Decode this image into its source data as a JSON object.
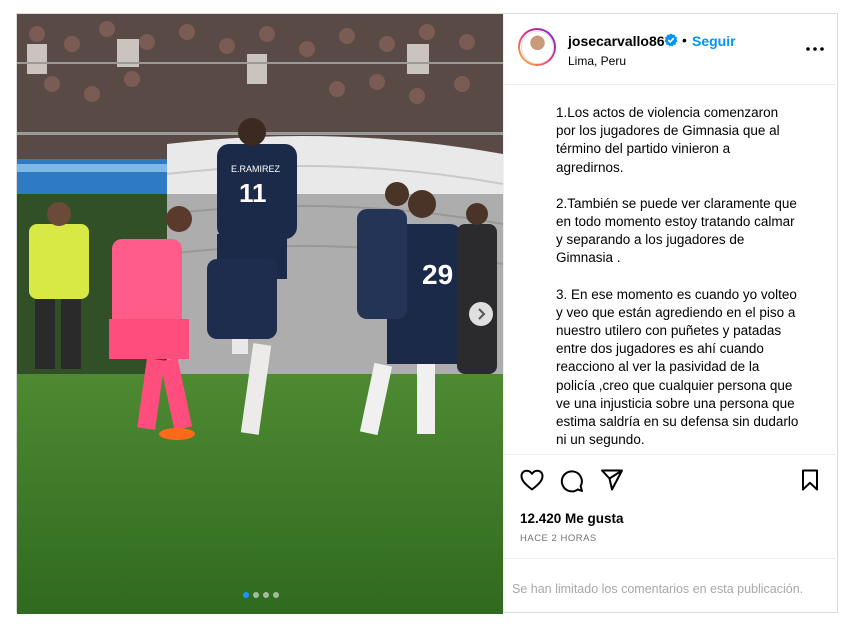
{
  "post": {
    "username": "josecarvallo86",
    "follow_label": "Seguir",
    "separator": "•",
    "location": "Lima, Peru",
    "caption": [
      "1.Los actos de violencia comenzaron por los jugadores de Gimnasia que al término del partido vinieron a agredirnos.",
      "2.También se puede ver claramente que en todo momento estoy tratando calmar y separando a los jugadores de Gimnasia .",
      "3. En ese momento es cuando yo volteo y veo que están agrediendo en el piso a nuestro utilero con puñetes y patadas entre dos jugadores es ahí cuando reacciono al ver la pasividad de la policía ,creo que cualquier persona que ve una injusticia sobre una persona que estima saldría en su defensa sin dudarlo ni un segundo."
    ],
    "likes": "12.420 Me gusta",
    "time": "HACE 2 HORAS",
    "comments_limited": "Se han limitado los comentarios en esta publicación.",
    "carousel": {
      "total": 4,
      "active": 1
    }
  },
  "photo": {
    "jersey_numbers": [
      "11",
      "29"
    ],
    "jersey_name": "E.RAMIREZ"
  },
  "colors": {
    "follow_blue": "#0095f6",
    "verified_blue": "#0095f6",
    "muted_text": "#737373",
    "jersey_navy": "#1c2a4a",
    "keeper_pink": "#ff5c8a"
  },
  "icons": [
    "verified-icon",
    "more-options-icon",
    "heart-icon",
    "comment-icon",
    "share-icon",
    "bookmark-icon",
    "chevron-right-icon"
  ]
}
